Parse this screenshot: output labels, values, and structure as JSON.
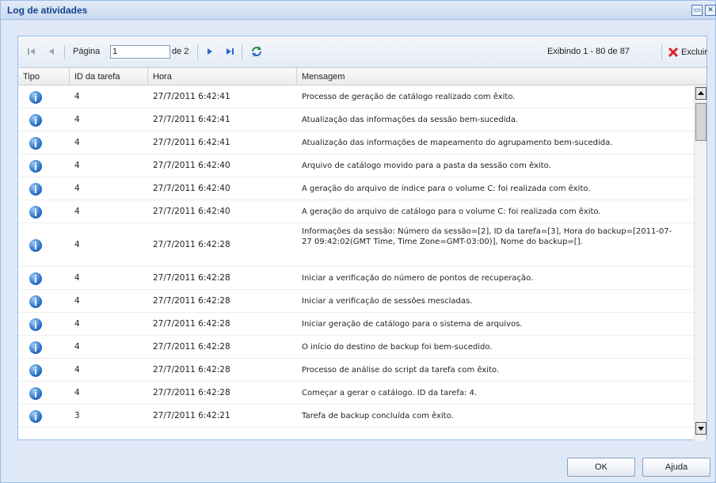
{
  "window": {
    "title": "Log de atividades",
    "maximize_glyph": "▭",
    "close_glyph": "✕"
  },
  "pager": {
    "page_label": "Página",
    "page_value": "1",
    "page_total": "de 2",
    "display_info": "Exibindo 1 - 80 de 87",
    "delete_label": "Excluir",
    "icons": [
      "first-page-icon",
      "prev-page-icon",
      "next-page-icon",
      "last-page-icon",
      "refresh-icon",
      "delete-x-icon"
    ]
  },
  "grid": {
    "columns": [
      "Tipo",
      "ID da tarefa",
      "Hora",
      "Mensagem"
    ],
    "rows": [
      {
        "type": "info",
        "task_id": "4",
        "time": "27/7/2011 6:42:41",
        "message": "Processo de geração de catálogo realizado com êxito."
      },
      {
        "type": "info",
        "task_id": "4",
        "time": "27/7/2011 6:42:41",
        "message": "Atualização das informações da sessão bem-sucedida."
      },
      {
        "type": "info",
        "task_id": "4",
        "time": "27/7/2011 6:42:41",
        "message": "Atualização das informações de mapeamento do agrupamento bem-sucedida."
      },
      {
        "type": "info",
        "task_id": "4",
        "time": "27/7/2011 6:42:40",
        "message": "Arquivo de catálogo movido para a pasta da sessão com êxito."
      },
      {
        "type": "info",
        "task_id": "4",
        "time": "27/7/2011 6:42:40",
        "message": "A geração do arquivo de índice para o volume C: foi realizada com êxito."
      },
      {
        "type": "info",
        "task_id": "4",
        "time": "27/7/2011 6:42:40",
        "message": "A geração do arquivo de catálogo para o volume C: foi realizada com êxito."
      },
      {
        "type": "info",
        "task_id": "4",
        "time": "27/7/2011 6:42:28",
        "message": "Informações da sessão: Número da sessão=[2], ID da tarefa=[3], Hora do backup=[2011-07-27 09:42:02(GMT Time, Time Zone=GMT-03:00)], Nome do backup=[]."
      },
      {
        "type": "info",
        "task_id": "4",
        "time": "27/7/2011 6:42:28",
        "message": "Iniciar a verificação do número de pontos de recuperação."
      },
      {
        "type": "info",
        "task_id": "4",
        "time": "27/7/2011 6:42:28",
        "message": "Iniciar a verificação de sessões mescladas."
      },
      {
        "type": "info",
        "task_id": "4",
        "time": "27/7/2011 6:42:28",
        "message": "Iniciar geração de catálogo para o sistema de arquivos."
      },
      {
        "type": "info",
        "task_id": "4",
        "time": "27/7/2011 6:42:28",
        "message": "O início do destino de backup foi bem-sucedido."
      },
      {
        "type": "info",
        "task_id": "4",
        "time": "27/7/2011 6:42:28",
        "message": "Processo de análise do script da tarefa com êxito."
      },
      {
        "type": "info",
        "task_id": "4",
        "time": "27/7/2011 6:42:28",
        "message": "Começar a gerar o catálogo. ID da tarefa: 4."
      },
      {
        "type": "info",
        "task_id": "3",
        "time": "27/7/2011 6:42:21",
        "message": "Tarefa de backup concluída com êxito."
      }
    ]
  },
  "footer": {
    "ok_label": "OK",
    "help_label": "Ajuda"
  },
  "colors": {
    "title": "#15428b",
    "window_bg": "#dfe8f6",
    "border": "#99bbe8",
    "delete_icon": "#d9262b"
  }
}
